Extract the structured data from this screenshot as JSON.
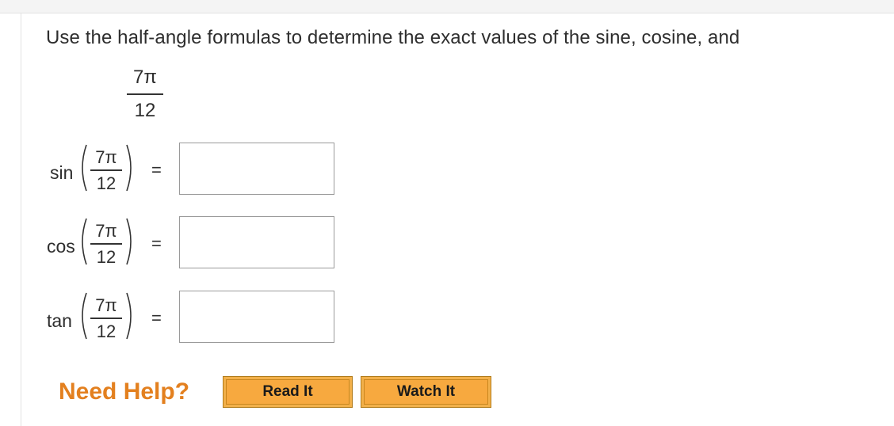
{
  "question": {
    "prompt": "Use the half-angle formulas to determine the exact values of the sine, cosine, and",
    "angle": {
      "numerator": "7π",
      "denominator": "12"
    }
  },
  "rows": [
    {
      "fn": "sin",
      "numerator": "7π",
      "denominator": "12",
      "equals": "=",
      "value": ""
    },
    {
      "fn": "cos",
      "numerator": "7π",
      "denominator": "12",
      "equals": "=",
      "value": ""
    },
    {
      "fn": "tan",
      "numerator": "7π",
      "denominator": "12",
      "equals": "=",
      "value": ""
    }
  ],
  "help": {
    "label": "Need Help?",
    "buttons": [
      "Read It",
      "Watch It"
    ]
  },
  "colors": {
    "help": "#e3801f",
    "button": "#f7a93f"
  }
}
